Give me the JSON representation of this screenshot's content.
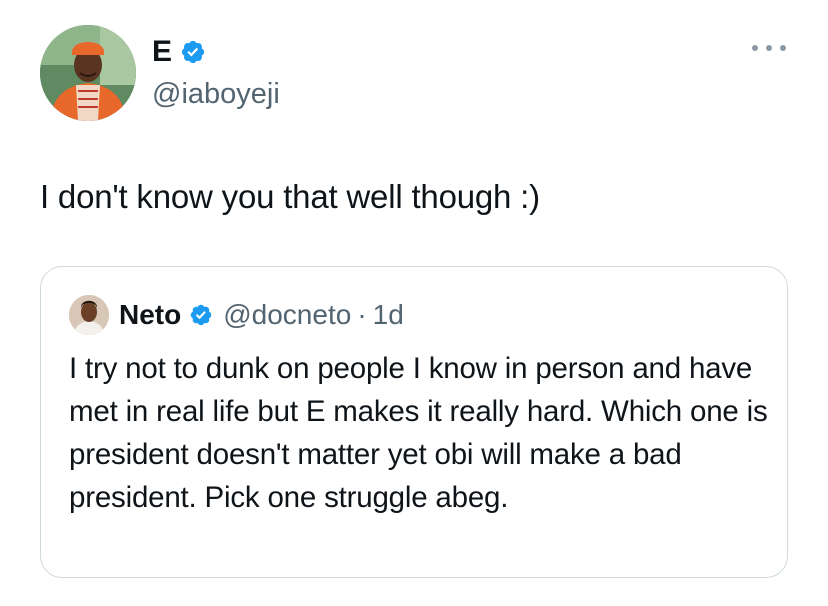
{
  "author": {
    "display_name": "E",
    "handle": "@iaboyeji",
    "avatar_icon": "profile-photo",
    "verified_icon": "verified-badge-icon"
  },
  "tweet": {
    "text": "I don't know you that well though :)"
  },
  "quoted": {
    "display_name": "Neto",
    "handle": "@docneto",
    "separator": "·",
    "time": "1d",
    "text": "I try not to dunk on people I know in person and have met in real life but E makes it really hard. Which one is president doesn't matter yet obi will make a bad president. Pick one struggle abeg."
  },
  "colors": {
    "verified": "#1d9bf0",
    "secondary_text": "#536471",
    "border": "#cfd9de"
  }
}
